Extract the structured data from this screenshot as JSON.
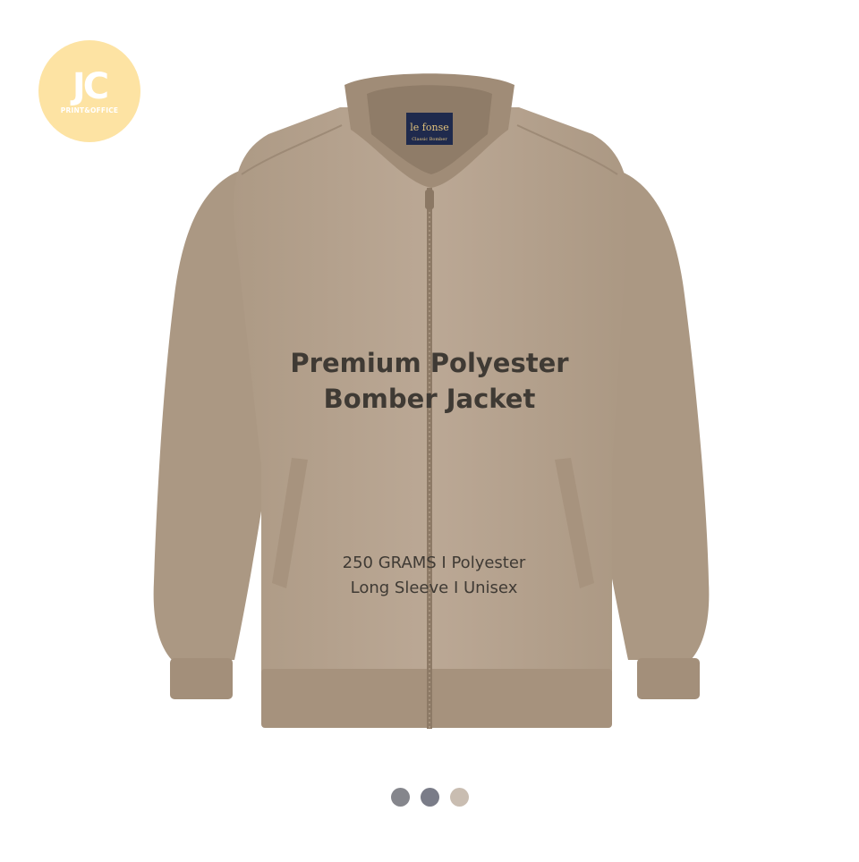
{
  "brand": {
    "logo_text": "JC",
    "logo_subtext": "PRINT&OFFICE",
    "logo_color": "#fde3a3"
  },
  "garment_label": {
    "brand_name": "le fonse",
    "tagline": "Classic Bomber"
  },
  "product": {
    "title_line1": "Premium Polyester",
    "title_line2": "Bomber Jacket",
    "spec_line1": "250 GRAMS I Polyester",
    "spec_line2": "Long Sleeve I Unisex",
    "jacket_color": "#b7a48f"
  },
  "color_options": [
    {
      "name": "grey",
      "color": "#85868c"
    },
    {
      "name": "slate",
      "color": "#7a7c88"
    },
    {
      "name": "khaki",
      "color": "#c9bdb1"
    }
  ]
}
